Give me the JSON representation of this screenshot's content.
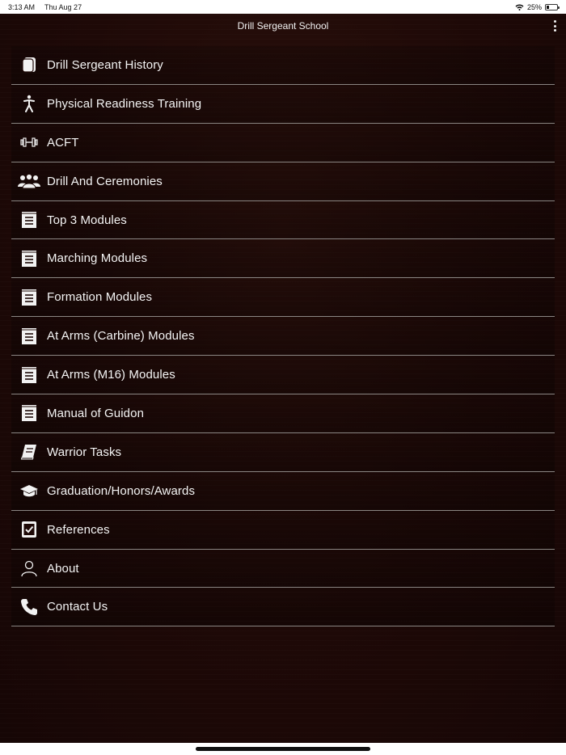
{
  "status_bar": {
    "time": "3:13 AM",
    "date": "Thu Aug 27",
    "battery_percent": "25%",
    "battery_level": 0.25
  },
  "header": {
    "title": "Drill Sergeant School"
  },
  "menu": {
    "items": [
      {
        "label": "Drill Sergeant History",
        "icon": "book-icon"
      },
      {
        "label": "Physical Readiness Training",
        "icon": "person-walking-icon"
      },
      {
        "label": "ACFT",
        "icon": "dumbbell-icon"
      },
      {
        "label": "Drill And Ceremonies",
        "icon": "group-icon"
      },
      {
        "label": "Top 3 Modules",
        "icon": "notepad-icon"
      },
      {
        "label": "Marching Modules",
        "icon": "notepad-icon"
      },
      {
        "label": "Formation Modules",
        "icon": "notepad-icon"
      },
      {
        "label": "At Arms (Carbine) Modules",
        "icon": "notepad-icon"
      },
      {
        "label": "At Arms (M16) Modules",
        "icon": "notepad-icon"
      },
      {
        "label": "Manual of Guidon",
        "icon": "notepad-icon"
      },
      {
        "label": "Warrior Tasks",
        "icon": "manual-book-icon"
      },
      {
        "label": "Graduation/Honors/Awards",
        "icon": "graduation-cap-icon"
      },
      {
        "label": "References",
        "icon": "checklist-icon"
      },
      {
        "label": "About",
        "icon": "user-outline-icon"
      },
      {
        "label": "Contact Us",
        "icon": "phone-icon"
      }
    ]
  },
  "colors": {
    "background_dark": "#1e0907",
    "divider": "#8a8582",
    "text": "#f4f4f4"
  }
}
